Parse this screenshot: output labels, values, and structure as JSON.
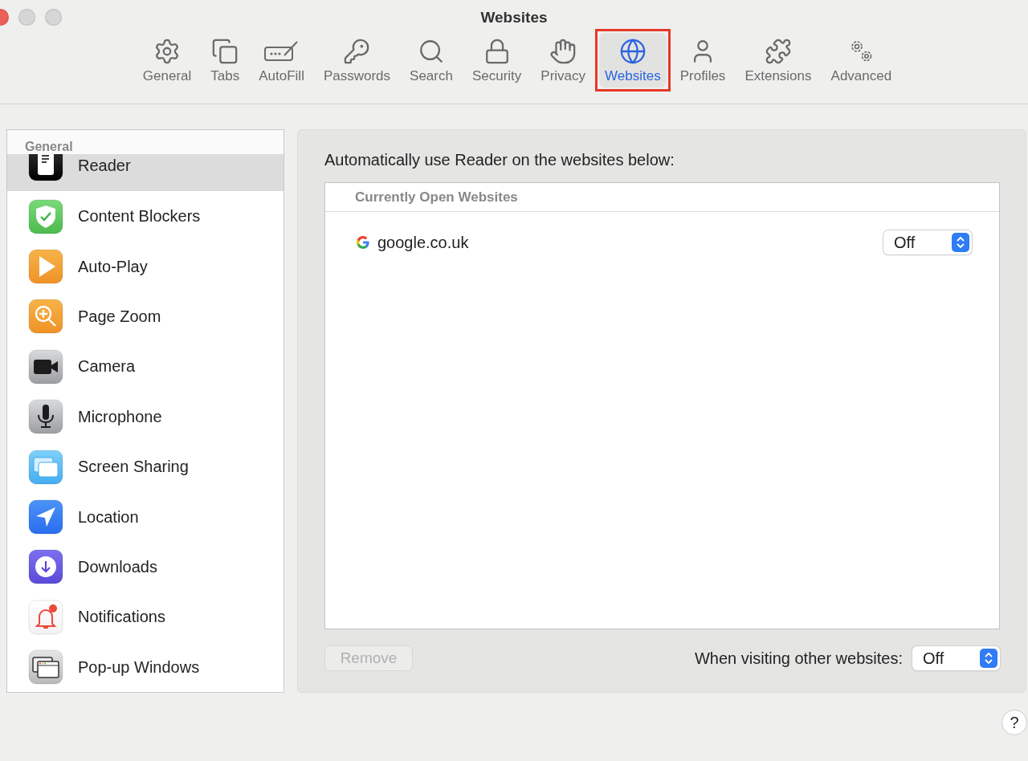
{
  "window": {
    "title": "Websites"
  },
  "toolbar": [
    {
      "label": "General",
      "selected": false,
      "highlighted": false
    },
    {
      "label": "Tabs",
      "selected": false,
      "highlighted": false
    },
    {
      "label": "AutoFill",
      "selected": false,
      "highlighted": false
    },
    {
      "label": "Passwords",
      "selected": false,
      "highlighted": false
    },
    {
      "label": "Search",
      "selected": false,
      "highlighted": false
    },
    {
      "label": "Security",
      "selected": false,
      "highlighted": false
    },
    {
      "label": "Privacy",
      "selected": false,
      "highlighted": false
    },
    {
      "label": "Websites",
      "selected": true,
      "highlighted": true
    },
    {
      "label": "Profiles",
      "selected": false,
      "highlighted": false
    },
    {
      "label": "Extensions",
      "selected": false,
      "highlighted": false
    },
    {
      "label": "Advanced",
      "selected": false,
      "highlighted": false
    }
  ],
  "sidebar": {
    "section": "General",
    "items": [
      {
        "label": "Reader",
        "selected": true
      },
      {
        "label": "Content Blockers",
        "selected": false
      },
      {
        "label": "Auto-Play",
        "selected": false
      },
      {
        "label": "Page Zoom",
        "selected": false
      },
      {
        "label": "Camera",
        "selected": false
      },
      {
        "label": "Microphone",
        "selected": false
      },
      {
        "label": "Screen Sharing",
        "selected": false
      },
      {
        "label": "Location",
        "selected": false
      },
      {
        "label": "Downloads",
        "selected": false
      },
      {
        "label": "Notifications",
        "selected": false
      },
      {
        "label": "Pop-up Windows",
        "selected": false
      }
    ]
  },
  "panel": {
    "heading": "Automatically use Reader on the websites below:",
    "table": {
      "header": "Currently Open Websites",
      "rows": [
        {
          "site": "google.co.uk",
          "setting": "Off"
        }
      ]
    },
    "remove_button": {
      "label": "Remove",
      "disabled": true
    },
    "other_label": "When visiting other websites:",
    "other_setting": "Off"
  },
  "help": "?"
}
